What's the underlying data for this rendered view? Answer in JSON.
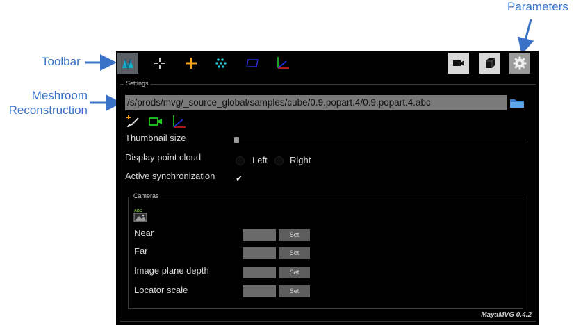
{
  "annotations": {
    "toolbar": "Toolbar",
    "meshroom_line1": "Meshroom",
    "meshroom_line2": "Reconstruction",
    "parameters": "Parameters"
  },
  "toolbar": {
    "left_buttons": [
      {
        "icon": "meshroom-logo-icon",
        "active": true
      },
      {
        "icon": "crosshair-icon",
        "active": false
      },
      {
        "icon": "plus-locator-icon",
        "active": false
      },
      {
        "icon": "point-cloud-icon",
        "active": false
      },
      {
        "icon": "image-plane-icon",
        "active": false
      },
      {
        "icon": "axis-icon",
        "active": false
      }
    ],
    "right_buttons": [
      {
        "icon": "camera-icon",
        "active": false
      },
      {
        "icon": "cube-icon",
        "active": false
      },
      {
        "icon": "gear-icon",
        "active": true
      }
    ]
  },
  "settings": {
    "title": "Settings",
    "path": "/s/prods/mvg/_source_global/samples/cube/0.9.popart.4/0.9.popart.4.abc",
    "thumbnail_label": "Thumbnail size",
    "point_cloud_label": "Display point cloud",
    "left_label": "Left",
    "right_label": "Right",
    "sync_label": "Active synchronization",
    "sync_checked_mark": "✔"
  },
  "cameras": {
    "title": "Cameras",
    "rows": [
      {
        "label": "Near",
        "button": "Set"
      },
      {
        "label": "Far",
        "button": "Set"
      },
      {
        "label": "Image plane depth",
        "button": "Set"
      },
      {
        "label": "Locator scale",
        "button": "Set"
      }
    ]
  },
  "version": "MayaMVG 0.4.2",
  "colors": {
    "annotation": "#3a72c8",
    "panel_bg": "#000000",
    "field_bg": "#7a7a7a",
    "active_btn": "#5a6066"
  }
}
